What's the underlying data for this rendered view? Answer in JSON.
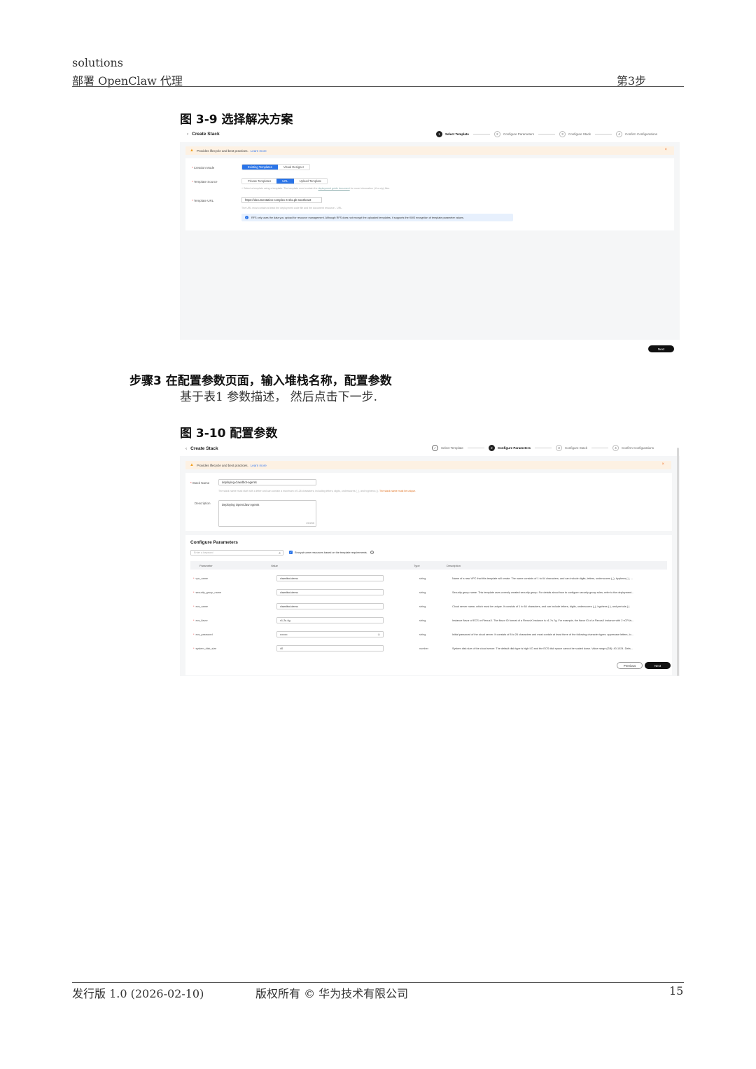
{
  "header": {
    "doc": "solutions",
    "section": "部署 OpenClaw 代理",
    "step": "第3步"
  },
  "figure1": {
    "caption": "图 3-9 选择解决方案",
    "title": "Create Stack",
    "steps": [
      "Select Template",
      "Configure Parameters",
      "Configure Stack",
      "Confirm Configurations"
    ],
    "step_numbers": [
      "1",
      "2",
      "3",
      "4"
    ],
    "notice": "Provides lifecycle and best practices.",
    "notice_link": "Learn more",
    "creation_mode_label": "Creation Mode",
    "creation_modes": [
      "Existing Templates",
      "Visual Designer"
    ],
    "template_source_label": "Template Source",
    "template_sources": [
      "Private Templates",
      "URL",
      "Upload Template"
    ],
    "source_hint_a": "+ Select a template using a template. The template must contain the",
    "source_hint_link": "deployment guide document",
    "source_hint_b": "for more information (.tf or.zip) files.",
    "template_url_label": "Template URL",
    "template_url_value": "https://documentation-complex-4-sbx.pb-southeast-",
    "url_hint": "The URL must contain at least the deployment code file and the document resource - URL.",
    "info_text": "RFS only uses the data you upload for resource management. Although RFS does not encrypt the uploaded templates, it supports the KMS encryption of template parameter values.",
    "next_label": "Next"
  },
  "step3": {
    "title": "步骤3 在配置参数页面，输入堆栈名称，配置参数",
    "desc": "基于表1 参数描述， 然后点击下一步."
  },
  "figure2": {
    "caption": "图 3-10 配置参数",
    "title": "Create Stack",
    "steps": [
      "Select Template",
      "Configure Parameters",
      "Configure Stack",
      "Confirm Configurations"
    ],
    "step_numbers": [
      "2",
      "3",
      "4"
    ],
    "notice": "Provides lifecycle and best practices.",
    "notice_link": "Learn more",
    "stack_name_label": "Stack Name",
    "stack_name_value": "deploying-clawdbot-agents",
    "stack_name_hint": "The stack name must start with a letter and can contain a maximum of 128 characters, including letters, digits, underscores (_), and hyphens (-).",
    "stack_name_warn": "The stack name must be unique.",
    "description_label": "Description",
    "description_value": "Deploying OpenClaw Agents",
    "description_count": "25/255",
    "configure_parameters_title": "Configure Parameters",
    "search_placeholder": "Enter a keyword",
    "encrypt_label": "Encrypt some resources based on the template requirements.",
    "columns": [
      "Parameter",
      "Value",
      "Type",
      "Description"
    ],
    "rows": [
      {
        "name": "vpc_name",
        "value": "clawdbot-demo",
        "type": "string",
        "desc": "Name of a new VPC that this template will create. The name consists of 1 to 64 characters, and can include digits, letters, underscores (_), hyphens (-), ..."
      },
      {
        "name": "security_group_name",
        "value": "clawdbot-demo",
        "type": "string",
        "desc": "Security group name. This template uses a newly created security group. For details about how to configure security group rules, refer to the deployment..."
      },
      {
        "name": "ecs_name",
        "value": "clawdbot-demo",
        "type": "string",
        "desc": "Cloud server name, which must be unique. It consists of 1 to 64 characters, and can include letters, digits, underscores (_), hyphens (-), and periods (.)."
      },
      {
        "name": "ecs_flavor",
        "value": "x1.2u.4g",
        "type": "string",
        "desc": "Instance flavor of ECS or FlexusX. The flavor ID format of a FlexusX instance is x1.?u.?g. For example, the flavor ID of a FlexusX instance with 2 vCPUs..."
      },
      {
        "name": "ecs_password",
        "value": "••••••••",
        "type": "string",
        "desc": "Initial password of the cloud server. It consists of 8 to 26 characters and must contain at least three of the following character types: uppercase letters, lo..."
      },
      {
        "name": "system_disk_size",
        "value": "40",
        "type": "number",
        "desc": "System disk size of the cloud server. The default disk type is high I/O and the ECS disk space cannot be scaled down. Value range (GB): 40-1024. Defa..."
      }
    ],
    "previous_label": "Previous",
    "next_label": "Next"
  },
  "footer": {
    "edition": "发行版 1.0 (2026-02-10)",
    "copyright": "版权所有 © 华为技术有限公司",
    "page": "15"
  }
}
